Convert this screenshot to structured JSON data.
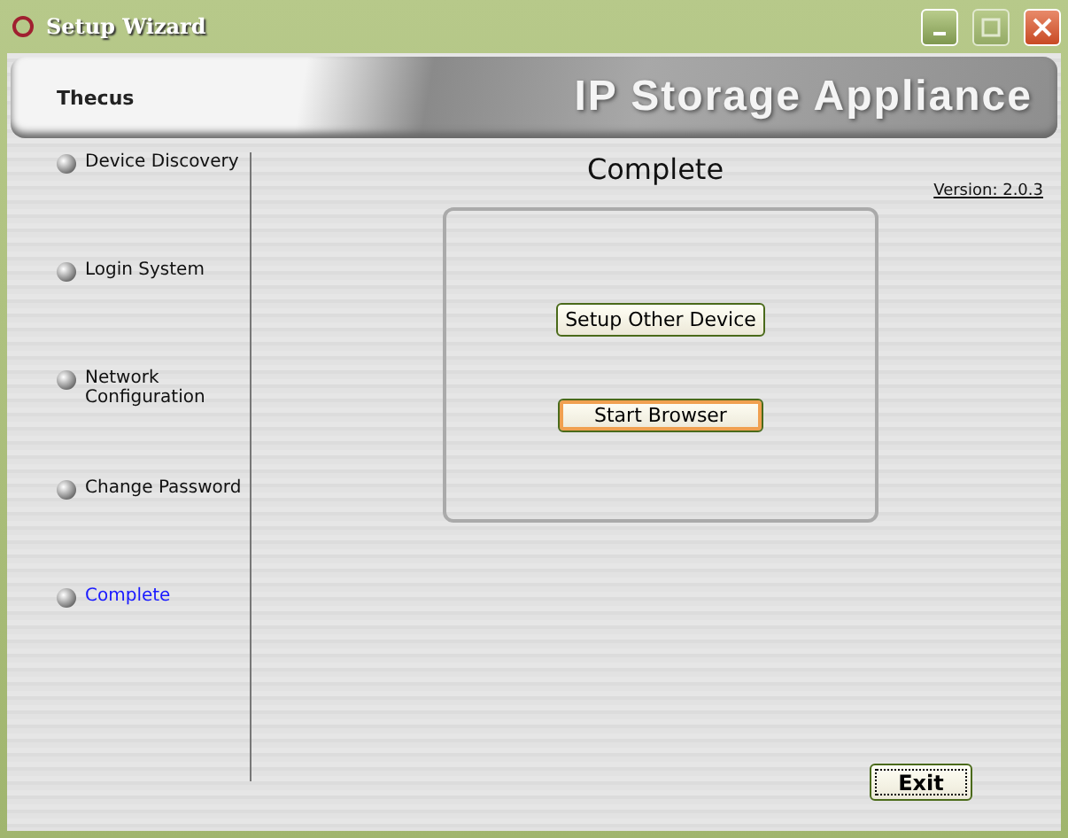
{
  "window": {
    "title": "Setup Wizard"
  },
  "banner": {
    "logo": "Thecus",
    "tagline": "IP Storage Appliance"
  },
  "steps": [
    {
      "label": "Device Discovery",
      "selected": false
    },
    {
      "label": "Login System",
      "selected": false
    },
    {
      "label": "Network Configuration",
      "selected": false
    },
    {
      "label": "Change Password",
      "selected": false
    },
    {
      "label": "Complete",
      "selected": true
    }
  ],
  "page": {
    "title": "Complete",
    "version": "Version: 2.0.3"
  },
  "actions": [
    {
      "label": "Setup Other Device",
      "hot": false
    },
    {
      "label": "Start Browser",
      "hot": true
    }
  ],
  "exit": {
    "label": "Exit",
    "focused": true
  }
}
